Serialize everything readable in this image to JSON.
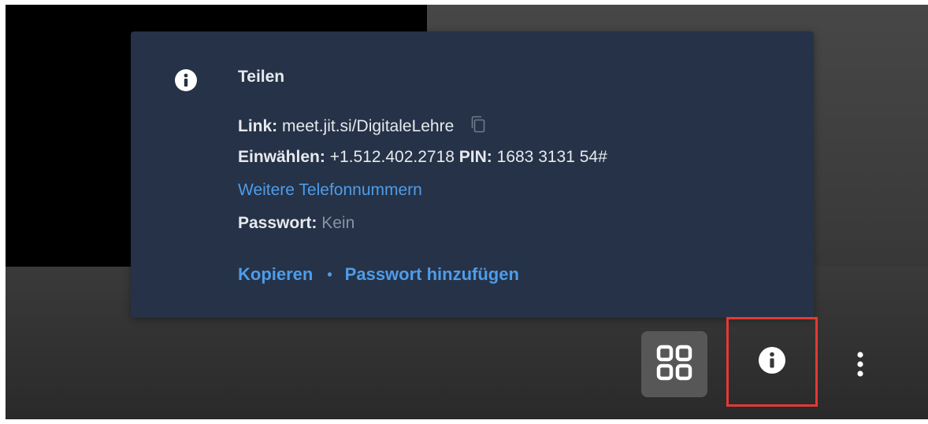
{
  "popover": {
    "title": "Teilen",
    "link_label": "Link:",
    "link_value": "meet.jit.si/DigitaleLehre",
    "dial_label": "Einwählen:",
    "dial_number": "+1.512.402.2718",
    "pin_label": "PIN:",
    "pin_value": "1683 3131 54#",
    "more_numbers": "Weitere Telefonnummern",
    "password_label": "Passwort:",
    "password_value": "Kein",
    "copy_action": "Kopieren",
    "separator": "•",
    "add_password_action": "Passwort hinzufügen"
  },
  "icons": {
    "popover_icon": "info-icon",
    "copy_icon": "copy-icon",
    "tile_icon": "tile-view-icon",
    "info_icon": "info-icon",
    "more_icon": "more-vertical-icon"
  },
  "colors": {
    "popover_background": "#253247",
    "link_blue": "#4f9ce8",
    "highlight_border": "#e53935",
    "tile_button_bg": "#575757"
  }
}
